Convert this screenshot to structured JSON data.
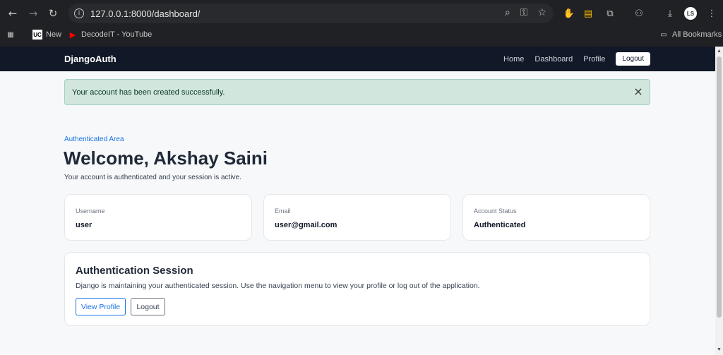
{
  "browser": {
    "url": "127.0.0.1:8000/dashboard/",
    "profile_initials": "LS",
    "bookmarks": [
      {
        "label": "New",
        "icon": "uc-icon"
      },
      {
        "label": "DecodeIT - YouTube",
        "icon": "youtube-icon"
      }
    ],
    "all_bookmarks": "All Bookmarks"
  },
  "navbar": {
    "brand": "DjangoAuth",
    "links": [
      "Home",
      "Dashboard",
      "Profile"
    ],
    "logout": "Logout"
  },
  "alert": {
    "message": "Your account has been created successfully.",
    "close": "×"
  },
  "hero": {
    "eyebrow": "Authenticated Area",
    "title": "Welcome, Akshay Saini",
    "subtitle": "Your account is authenticated and your session is active."
  },
  "cards": [
    {
      "label": "Username",
      "value": "user"
    },
    {
      "label": "Email",
      "value": "user@gmail.com"
    },
    {
      "label": "Account Status",
      "value": "Authenticated"
    }
  ],
  "session": {
    "title": "Authentication Session",
    "description": "Django is maintaining your authenticated session. Use the navigation menu to view your profile or log out of the application.",
    "view_profile": "View Profile",
    "logout": "Logout"
  },
  "colors": {
    "navbar": "#111827",
    "accent": "#1a73e8",
    "alert_bg": "#d1e7dd"
  }
}
